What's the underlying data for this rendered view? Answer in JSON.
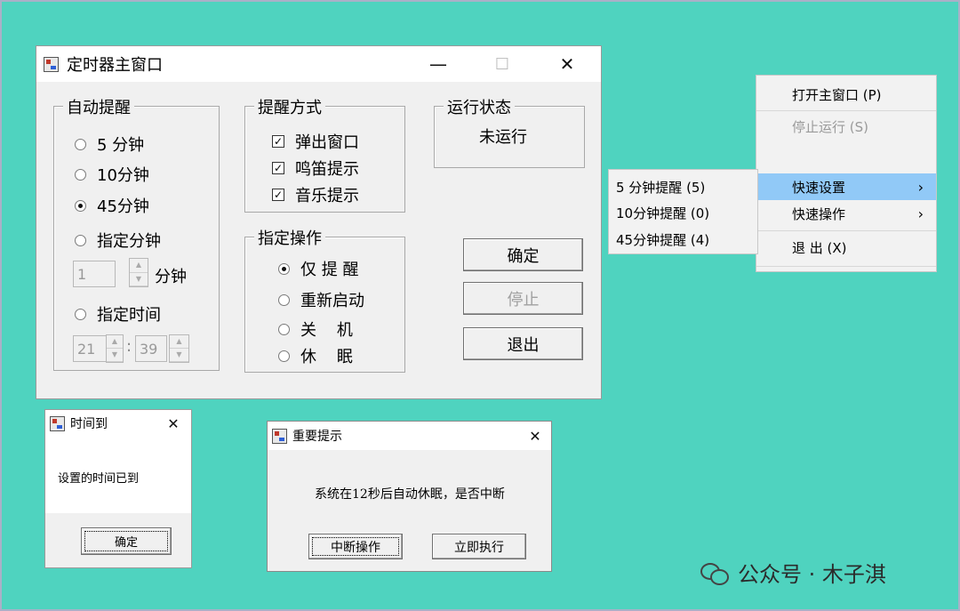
{
  "main_window": {
    "title": "定时器主窗口",
    "minimize_glyph": "—",
    "maximize_glyph": "☐",
    "close_glyph": "✕",
    "reminder_group": {
      "title": "自动提醒",
      "options": [
        "5 分钟",
        "10分钟",
        "45分钟",
        "指定分钟"
      ],
      "selected_index": 2,
      "minutes_value": "1",
      "minutes_unit": "分钟",
      "specified_time_label": "指定时间",
      "hour_value": "21",
      "time_separator": ":",
      "minute_value": "39"
    },
    "method_group": {
      "title": "提醒方式",
      "options": [
        "弹出窗口",
        "鸣笛提示",
        "音乐提示"
      ],
      "checked": [
        true,
        true,
        true
      ],
      "check_glyph": "✓"
    },
    "action_group": {
      "title": "指定操作",
      "options": [
        "仅 提 醒",
        "重新启动",
        "关    机",
        "休    眠"
      ],
      "selected_index": 0
    },
    "status_group": {
      "title": "运行状态",
      "value": "未运行"
    },
    "buttons": {
      "ok": "确定",
      "stop": "停止",
      "exit": "退出"
    }
  },
  "tray_menu": {
    "open": "打开主窗口 (P)",
    "stop": "停止运行 (S)",
    "quick_settings": "快速设置",
    "quick_actions": "快速操作",
    "exit": "退      出 (X)",
    "arrow_glyph": "›"
  },
  "submenu": {
    "items": [
      "5 分钟提醒 (5)",
      "10分钟提醒 (0)",
      "45分钟提醒 (4)"
    ]
  },
  "time_up_dialog": {
    "title": "时间到",
    "close_glyph": "✕",
    "message": "设置的时间已到",
    "ok": "确定"
  },
  "notice_dialog": {
    "title": "重要提示",
    "close_glyph": "✕",
    "message": "系统在12秒后自动休眠，是否中断",
    "interrupt": "中断操作",
    "execute": "立即执行"
  },
  "watermark": "公众号 · 木子淇",
  "colors": {
    "background": "#4fd3bf",
    "menu_highlight": "#91c9f7",
    "disabled_text": "#a0a0a0"
  }
}
